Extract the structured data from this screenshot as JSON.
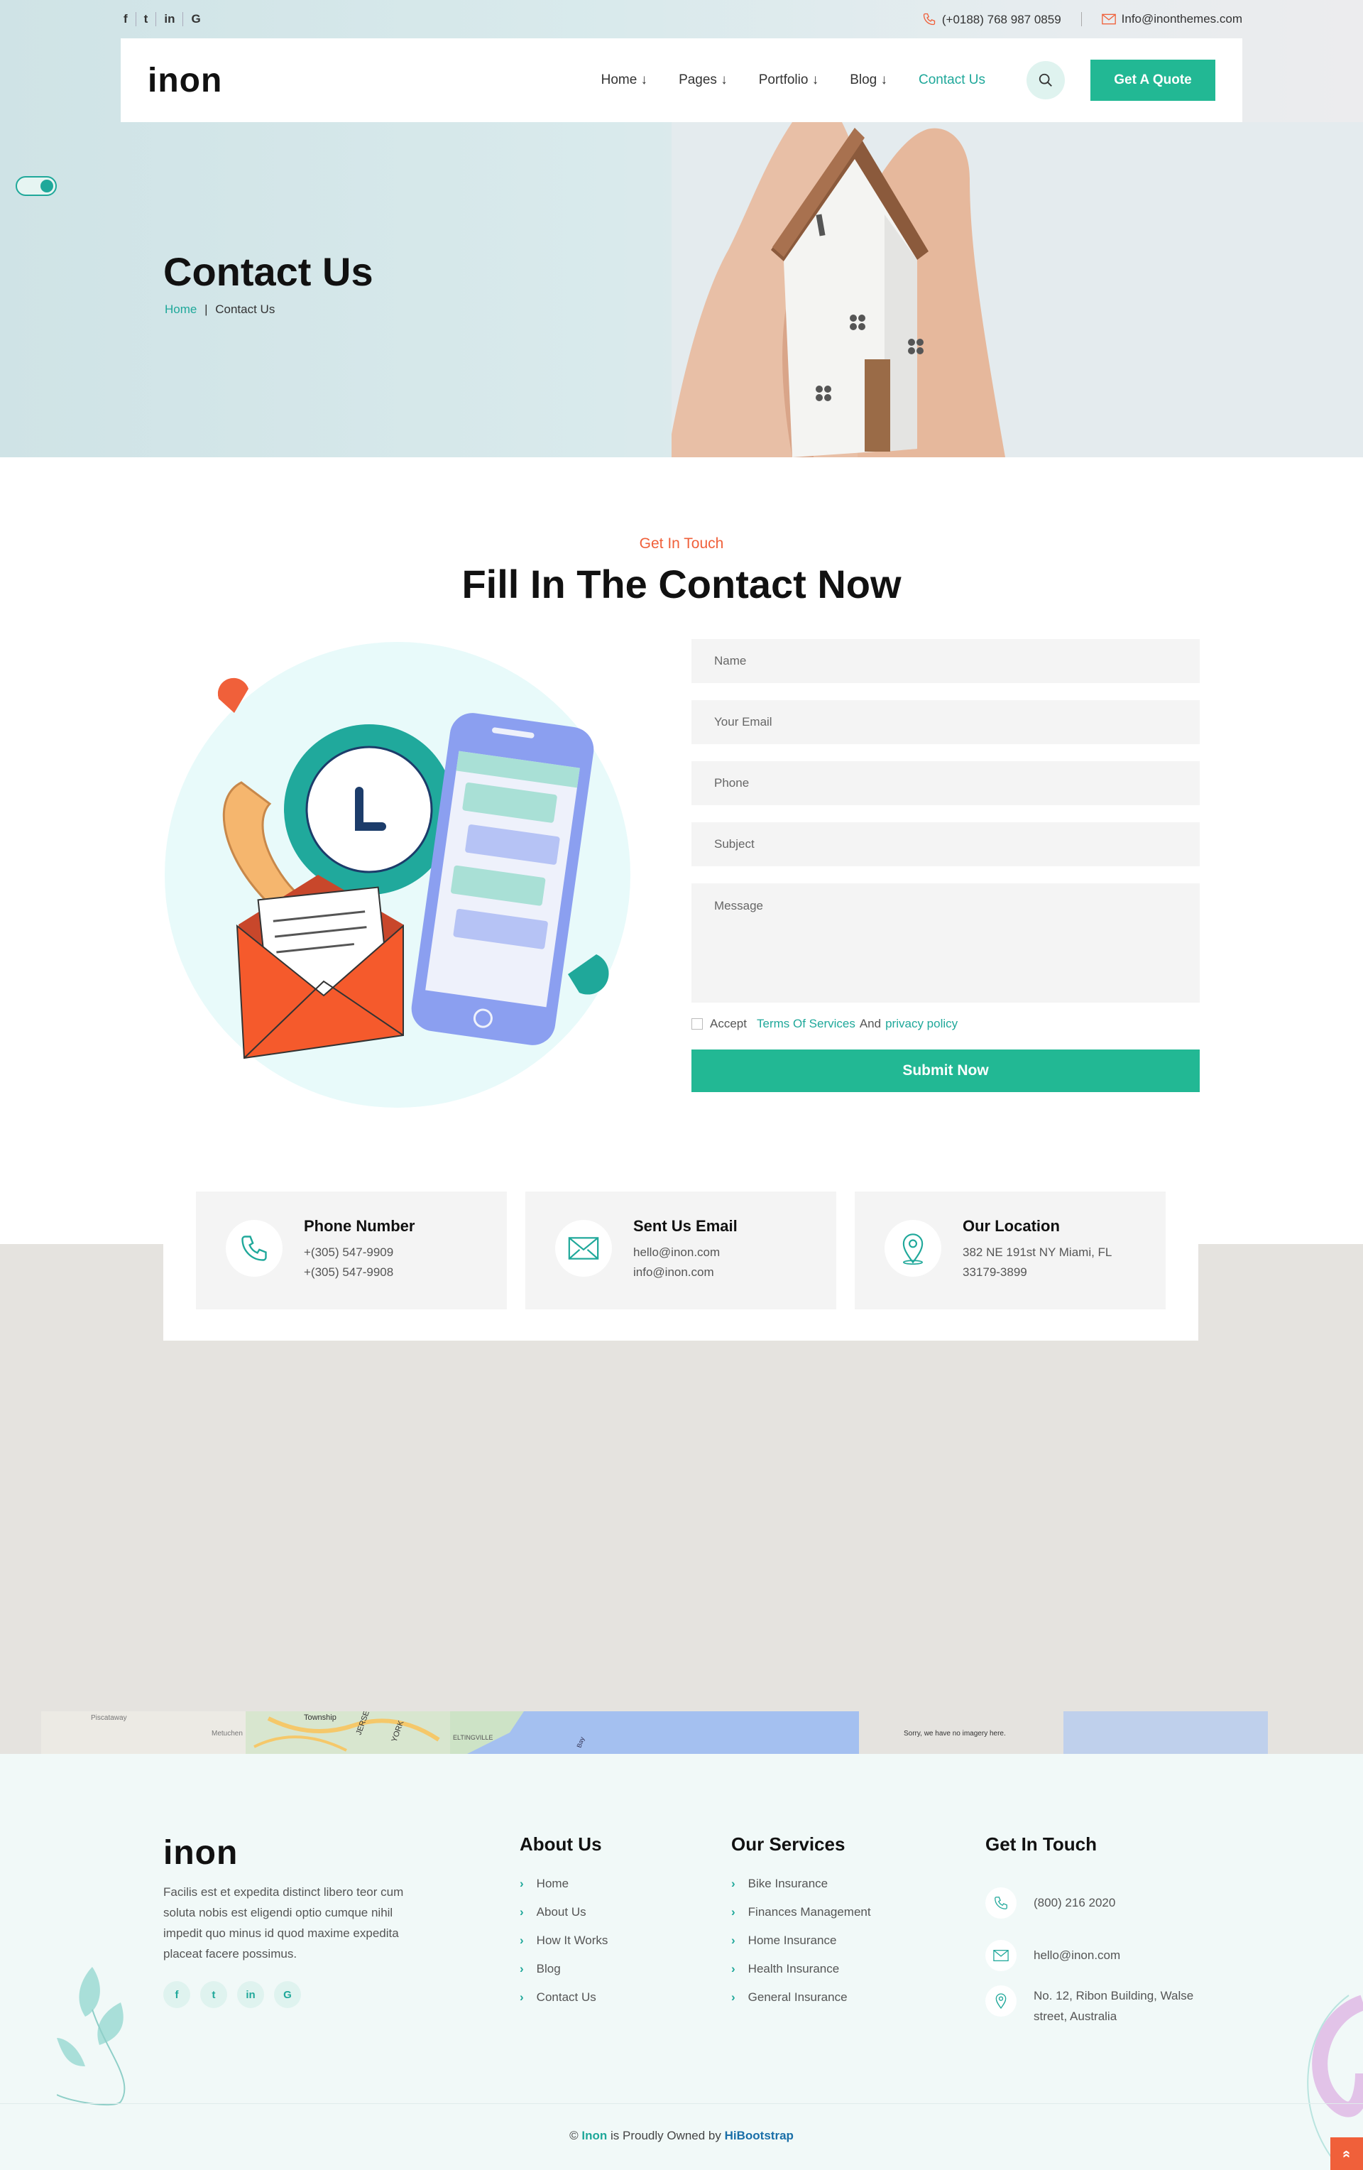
{
  "topbar": {
    "social": [
      "f",
      "t",
      "in",
      "G"
    ],
    "phone": "(+0188) 768 987 0859",
    "email": "Info@inonthemes.com"
  },
  "nav": {
    "logo": "inon",
    "items": [
      "Home ↓",
      "Pages ↓",
      "Portfolio ↓",
      "Blog ↓",
      "Contact Us"
    ],
    "quote_label": "Get A Quote"
  },
  "hero": {
    "title": "Contact Us",
    "crumb_home": "Home",
    "crumb_sep": "|",
    "crumb_current": "Contact Us"
  },
  "contact_section": {
    "eyebrow": "Get In Touch",
    "title": "Fill In The Contact Now"
  },
  "form": {
    "name_ph": "Name",
    "email_ph": "Your Email",
    "phone_ph": "Phone",
    "subject_ph": "Subject",
    "message_ph": "Message",
    "accept": "Accept",
    "terms": "Terms Of Services",
    "and": "And",
    "privacy": "privacy policy",
    "submit": "Submit Now"
  },
  "info_cards": [
    {
      "title": "Phone Number",
      "line1": "+(305) 547-9909",
      "line2": "+(305) 547-9908",
      "icon": "phone-icon"
    },
    {
      "title": "Sent Us Email",
      "line1": "hello@inon.com",
      "line2": "info@inon.com",
      "icon": "mail-icon"
    },
    {
      "title": "Our Location",
      "line1": "382 NE 191st NY Miami, FL",
      "line2": "33179-3899",
      "icon": "map-pin-icon"
    }
  ],
  "map": {
    "labels": [
      "Piscataway",
      "Metuchen",
      "Township",
      "JERSEY",
      "YORK",
      "ELTINGVILLE",
      "Bay"
    ],
    "no_imagery": "Sorry, we have no imagery here."
  },
  "footer": {
    "logo": "inon",
    "desc": "Facilis est et expedita distinct libero teor cum soluta nobis est eligendi optio cumque nihil impedit quo minus id quod maxime expedita placeat facere possimus.",
    "social": [
      "f",
      "t",
      "in",
      "G"
    ],
    "about_title": "About Us",
    "about_links": [
      "Home",
      "About Us",
      "How It Works",
      "Blog",
      "Contact Us"
    ],
    "services_title": "Our Services",
    "services_links": [
      "Bike Insurance",
      "Finances Management",
      "Home Insurance",
      "Health Insurance",
      "General Insurance"
    ],
    "touch_title": "Get In Touch",
    "touch_phone": "(800) 216 2020",
    "touch_email": "hello@inon.com",
    "touch_address": "No. 12, Ribon Building, Walse street, Australia",
    "copy_pre": "©",
    "copy_brand": "Inon",
    "copy_mid": "is Proudly Owned by",
    "copy_owner": "HiBootstrap"
  },
  "colors": {
    "accent": "#22b894",
    "teal": "#1fa89a",
    "orange": "#f0603a"
  }
}
